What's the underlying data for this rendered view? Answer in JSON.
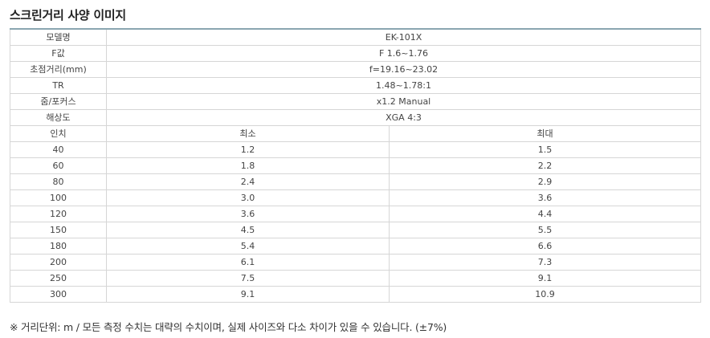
{
  "title": "스크린거리 사양 이미지",
  "specs": [
    {
      "label": "모델명",
      "value": "EK-101X"
    },
    {
      "label": "F값",
      "value": "F 1.6~1.76"
    },
    {
      "label": "초점거리(mm)",
      "value": "f=19.16~23.02"
    },
    {
      "label": "TR",
      "value": "1.48~1.78:1"
    },
    {
      "label": "줌/포커스",
      "value": "x1.2 Manual"
    },
    {
      "label": "해상도",
      "value": "XGA 4:3"
    }
  ],
  "distance_table": {
    "headers": [
      "인치",
      "최소",
      "최대"
    ],
    "rows": [
      [
        "40",
        "1.2",
        "1.5"
      ],
      [
        "60",
        "1.8",
        "2.2"
      ],
      [
        "80",
        "2.4",
        "2.9"
      ],
      [
        "100",
        "3.0",
        "3.6"
      ],
      [
        "120",
        "3.6",
        "4.4"
      ],
      [
        "150",
        "4.5",
        "5.5"
      ],
      [
        "180",
        "5.4",
        "6.6"
      ],
      [
        "200",
        "6.1",
        "7.3"
      ],
      [
        "250",
        "7.5",
        "9.1"
      ],
      [
        "300",
        "9.1",
        "10.9"
      ]
    ]
  },
  "footnote": "※ 거리단위: m / 모든 측정 수치는 대략의 수치이며, 실제 사이즈와 다소 차이가 있을 수 있습니다. (±7%)"
}
